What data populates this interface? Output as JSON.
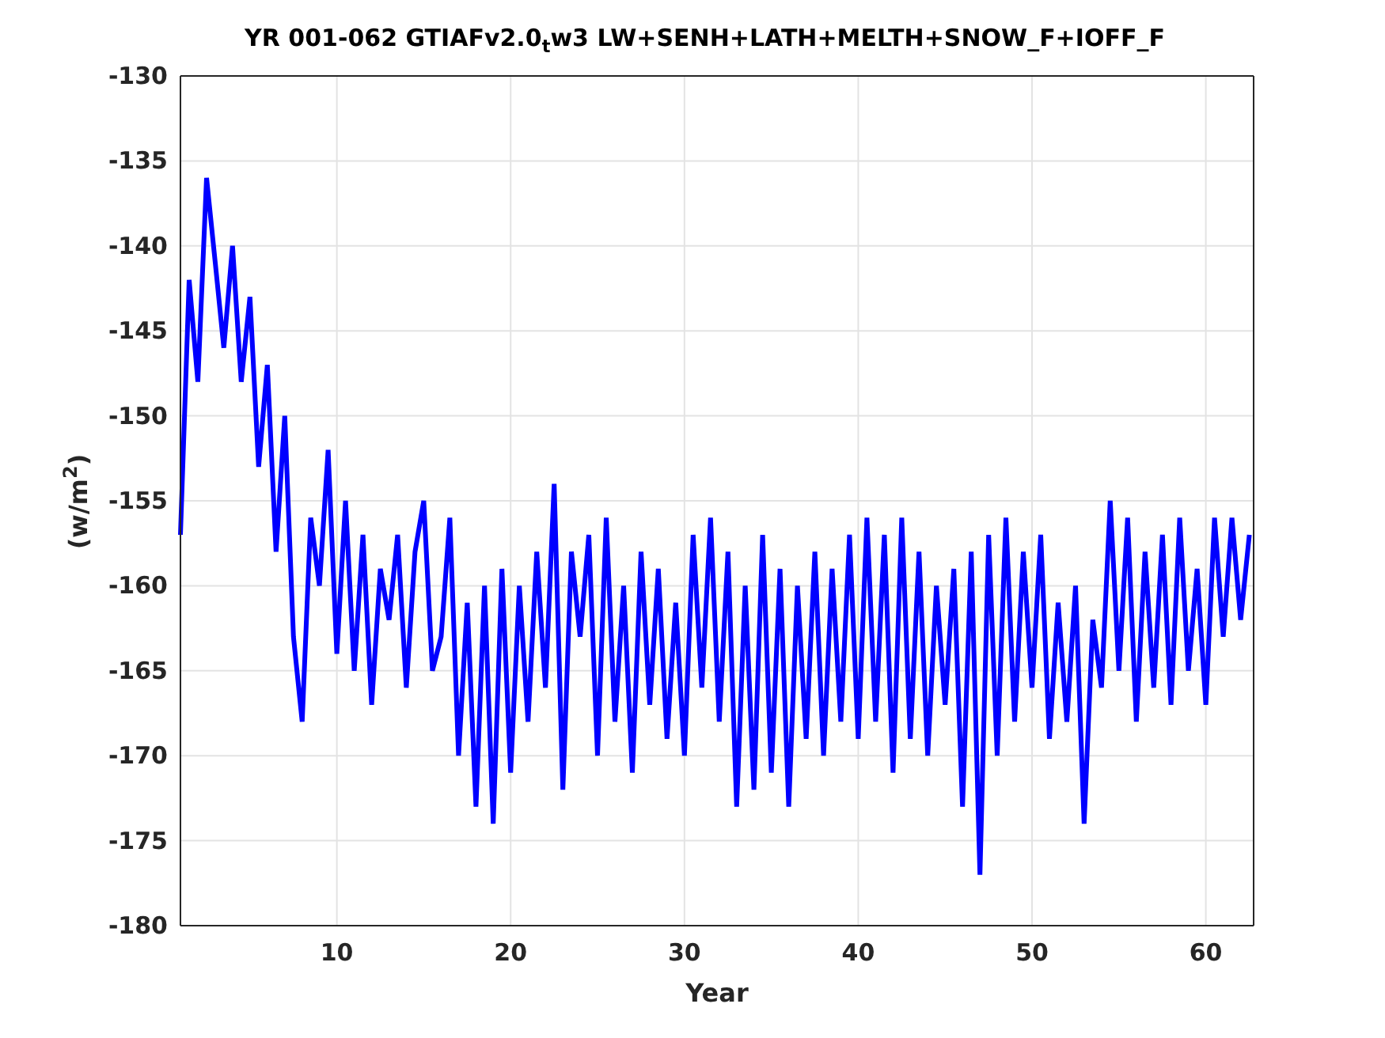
{
  "figure": {
    "chart_data": {
      "type": "line",
      "title": "YR 001-062 GTIAFv2.0$_{t}$w3 LW+SENH+LATH+MELTH+SNOW_F+IOFF_F",
      "xlabel": "Year",
      "grid": true,
      "x": [
        1,
        1.5,
        2,
        2.5,
        3,
        3.5,
        4,
        4.5,
        5,
        5.5,
        6,
        6.5,
        7,
        7.5,
        8,
        8.5,
        9,
        9.5,
        10,
        10.5,
        11,
        11.5,
        12,
        12.5,
        13,
        13.5,
        14,
        14.5,
        15,
        15.5,
        16,
        16.5,
        17,
        17.5,
        18,
        18.5,
        19,
        19.5,
        20,
        20.5,
        21,
        21.5,
        22,
        22.5,
        23,
        23.5,
        24,
        24.5,
        25,
        25.5,
        26,
        26.5,
        27,
        27.5,
        28,
        28.5,
        29,
        29.5,
        30,
        30.5,
        31,
        31.5,
        32,
        32.5,
        33,
        33.5,
        34,
        34.5,
        35,
        35.5,
        36,
        36.5,
        37,
        37.5,
        38,
        38.5,
        39,
        39.5,
        40,
        40.5,
        41,
        41.5,
        42,
        42.5,
        43,
        43.5,
        44,
        44.5,
        45,
        45.5,
        46,
        46.5,
        47,
        47.5,
        48,
        48.5,
        49,
        49.5,
        50,
        50.5,
        51,
        51.5,
        52,
        52.5,
        53,
        53.5,
        54,
        54.5,
        55,
        55.5,
        56,
        56.5,
        57,
        57.5,
        58,
        58.5,
        59,
        59.5,
        60,
        60.5,
        61,
        61.5,
        62,
        62.5
      ],
      "ylabel": "(w/m$^{2}$)",
      "xlim": [
        1,
        62.75
      ],
      "ylim": [
        -180,
        -130
      ],
      "xticks": [
        10,
        20,
        30,
        40,
        50,
        60
      ],
      "yticks": [
        -180,
        -175,
        -170,
        -165,
        -160,
        -155,
        -150,
        -145,
        -140,
        -135,
        -130
      ],
      "series": [
        {
          "color": "#0000ff",
          "values": [
            -157,
            -142,
            -148,
            -136,
            -141,
            -146,
            -140,
            -148,
            -143,
            -153,
            -147,
            -158,
            -150,
            -163,
            -168,
            -156,
            -160,
            -152,
            -164,
            -155,
            -165,
            -157,
            -167,
            -159,
            -162,
            -157,
            -166,
            -158,
            -155,
            -165,
            -163,
            -156,
            -170,
            -161,
            -173,
            -160,
            -174,
            -159,
            -171,
            -160,
            -168,
            -158,
            -166,
            -154,
            -172,
            -158,
            -163,
            -157,
            -170,
            -156,
            -168,
            -160,
            -171,
            -158,
            -167,
            -159,
            -169,
            -161,
            -170,
            -157,
            -166,
            -156,
            -168,
            -158,
            -173,
            -160,
            -172,
            -157,
            -171,
            -159,
            -173,
            -160,
            -169,
            -158,
            -170,
            -159,
            -168,
            -157,
            -169,
            -156,
            -168,
            -157,
            -171,
            -156,
            -169,
            -158,
            -170,
            -160,
            -167,
            -159,
            -173,
            -158,
            -177,
            -157,
            -170,
            -156,
            -168,
            -158,
            -166,
            -157,
            -169,
            -161,
            -168,
            -160,
            -174,
            -162,
            -166,
            -155,
            -165,
            -156,
            -168,
            -158,
            -166,
            -157,
            -167,
            -156,
            -165,
            -159,
            -167,
            -156,
            -163,
            -156,
            -162,
            -157
          ]
        }
      ]
    }
  }
}
